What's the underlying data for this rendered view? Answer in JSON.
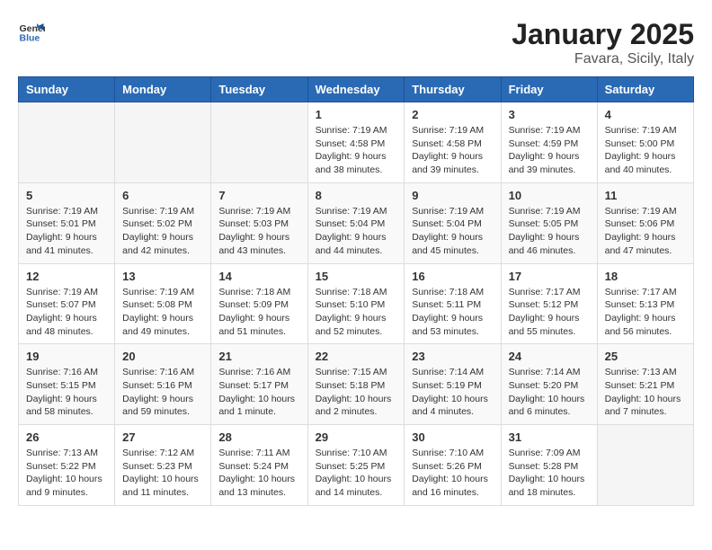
{
  "header": {
    "logo_general": "General",
    "logo_blue": "Blue",
    "title": "January 2025",
    "subtitle": "Favara, Sicily, Italy"
  },
  "calendar": {
    "days_of_week": [
      "Sunday",
      "Monday",
      "Tuesday",
      "Wednesday",
      "Thursday",
      "Friday",
      "Saturday"
    ],
    "weeks": [
      [
        {
          "day": "",
          "info": ""
        },
        {
          "day": "",
          "info": ""
        },
        {
          "day": "",
          "info": ""
        },
        {
          "day": "1",
          "info": "Sunrise: 7:19 AM\nSunset: 4:58 PM\nDaylight: 9 hours\nand 38 minutes."
        },
        {
          "day": "2",
          "info": "Sunrise: 7:19 AM\nSunset: 4:58 PM\nDaylight: 9 hours\nand 39 minutes."
        },
        {
          "day": "3",
          "info": "Sunrise: 7:19 AM\nSunset: 4:59 PM\nDaylight: 9 hours\nand 39 minutes."
        },
        {
          "day": "4",
          "info": "Sunrise: 7:19 AM\nSunset: 5:00 PM\nDaylight: 9 hours\nand 40 minutes."
        }
      ],
      [
        {
          "day": "5",
          "info": "Sunrise: 7:19 AM\nSunset: 5:01 PM\nDaylight: 9 hours\nand 41 minutes."
        },
        {
          "day": "6",
          "info": "Sunrise: 7:19 AM\nSunset: 5:02 PM\nDaylight: 9 hours\nand 42 minutes."
        },
        {
          "day": "7",
          "info": "Sunrise: 7:19 AM\nSunset: 5:03 PM\nDaylight: 9 hours\nand 43 minutes."
        },
        {
          "day": "8",
          "info": "Sunrise: 7:19 AM\nSunset: 5:04 PM\nDaylight: 9 hours\nand 44 minutes."
        },
        {
          "day": "9",
          "info": "Sunrise: 7:19 AM\nSunset: 5:04 PM\nDaylight: 9 hours\nand 45 minutes."
        },
        {
          "day": "10",
          "info": "Sunrise: 7:19 AM\nSunset: 5:05 PM\nDaylight: 9 hours\nand 46 minutes."
        },
        {
          "day": "11",
          "info": "Sunrise: 7:19 AM\nSunset: 5:06 PM\nDaylight: 9 hours\nand 47 minutes."
        }
      ],
      [
        {
          "day": "12",
          "info": "Sunrise: 7:19 AM\nSunset: 5:07 PM\nDaylight: 9 hours\nand 48 minutes."
        },
        {
          "day": "13",
          "info": "Sunrise: 7:19 AM\nSunset: 5:08 PM\nDaylight: 9 hours\nand 49 minutes."
        },
        {
          "day": "14",
          "info": "Sunrise: 7:18 AM\nSunset: 5:09 PM\nDaylight: 9 hours\nand 51 minutes."
        },
        {
          "day": "15",
          "info": "Sunrise: 7:18 AM\nSunset: 5:10 PM\nDaylight: 9 hours\nand 52 minutes."
        },
        {
          "day": "16",
          "info": "Sunrise: 7:18 AM\nSunset: 5:11 PM\nDaylight: 9 hours\nand 53 minutes."
        },
        {
          "day": "17",
          "info": "Sunrise: 7:17 AM\nSunset: 5:12 PM\nDaylight: 9 hours\nand 55 minutes."
        },
        {
          "day": "18",
          "info": "Sunrise: 7:17 AM\nSunset: 5:13 PM\nDaylight: 9 hours\nand 56 minutes."
        }
      ],
      [
        {
          "day": "19",
          "info": "Sunrise: 7:16 AM\nSunset: 5:15 PM\nDaylight: 9 hours\nand 58 minutes."
        },
        {
          "day": "20",
          "info": "Sunrise: 7:16 AM\nSunset: 5:16 PM\nDaylight: 9 hours\nand 59 minutes."
        },
        {
          "day": "21",
          "info": "Sunrise: 7:16 AM\nSunset: 5:17 PM\nDaylight: 10 hours\nand 1 minute."
        },
        {
          "day": "22",
          "info": "Sunrise: 7:15 AM\nSunset: 5:18 PM\nDaylight: 10 hours\nand 2 minutes."
        },
        {
          "day": "23",
          "info": "Sunrise: 7:14 AM\nSunset: 5:19 PM\nDaylight: 10 hours\nand 4 minutes."
        },
        {
          "day": "24",
          "info": "Sunrise: 7:14 AM\nSunset: 5:20 PM\nDaylight: 10 hours\nand 6 minutes."
        },
        {
          "day": "25",
          "info": "Sunrise: 7:13 AM\nSunset: 5:21 PM\nDaylight: 10 hours\nand 7 minutes."
        }
      ],
      [
        {
          "day": "26",
          "info": "Sunrise: 7:13 AM\nSunset: 5:22 PM\nDaylight: 10 hours\nand 9 minutes."
        },
        {
          "day": "27",
          "info": "Sunrise: 7:12 AM\nSunset: 5:23 PM\nDaylight: 10 hours\nand 11 minutes."
        },
        {
          "day": "28",
          "info": "Sunrise: 7:11 AM\nSunset: 5:24 PM\nDaylight: 10 hours\nand 13 minutes."
        },
        {
          "day": "29",
          "info": "Sunrise: 7:10 AM\nSunset: 5:25 PM\nDaylight: 10 hours\nand 14 minutes."
        },
        {
          "day": "30",
          "info": "Sunrise: 7:10 AM\nSunset: 5:26 PM\nDaylight: 10 hours\nand 16 minutes."
        },
        {
          "day": "31",
          "info": "Sunrise: 7:09 AM\nSunset: 5:28 PM\nDaylight: 10 hours\nand 18 minutes."
        },
        {
          "day": "",
          "info": ""
        }
      ]
    ]
  }
}
